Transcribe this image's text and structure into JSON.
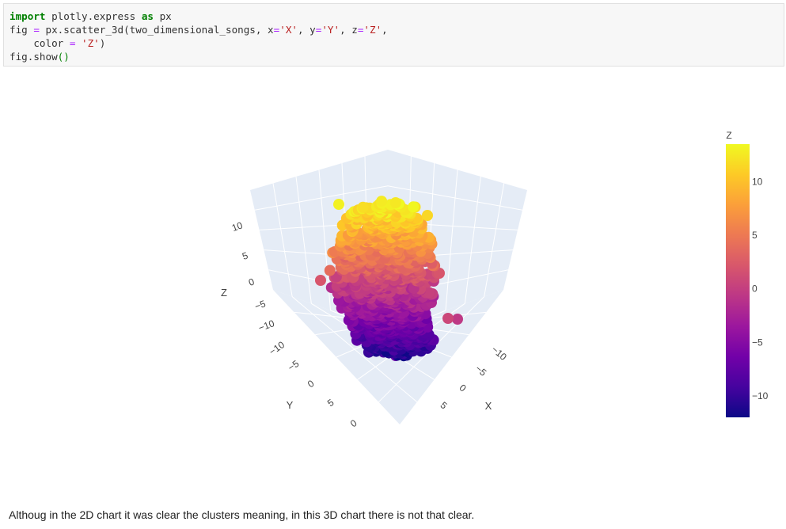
{
  "code": {
    "line1": {
      "kw1": "import",
      "mod": " plotly.express ",
      "kw2": "as",
      "alias": " px"
    },
    "line2": {
      "pre": "fig ",
      "eq": "=",
      "call": " px.scatter_3d(two_dimensional_songs, x",
      "eq2": "=",
      "xv": "'X'",
      "mid1": ", y",
      "eq3": "=",
      "yv": "'Y'",
      "mid2": ", z",
      "eq4": "=",
      "zv": "'Z'",
      "end": ","
    },
    "line3": {
      "pre": "    color ",
      "eq": "=",
      "sp": " ",
      "val": "'Z'",
      "end": ")"
    },
    "line4": {
      "pre": "fig.show",
      "paren": "()"
    }
  },
  "markdown_text": "Althoug in the 2D chart it was clear the clusters meaning, in this 3D chart there is not that clear.",
  "chart_data": {
    "type": "scatter",
    "subtype": "scatter_3d",
    "x_label": "X",
    "y_label": "Y",
    "z_label": "Z",
    "x_ticks": [
      "5",
      "0",
      "−5",
      "−10"
    ],
    "y_ticks": [
      "−10",
      "−5",
      "0",
      "5",
      "0"
    ],
    "z_ticks": [
      "10",
      "5",
      "0",
      "−5",
      "−10"
    ],
    "colorbar_title": "Z",
    "colorbar_ticks": [
      "10",
      "5",
      "0",
      "−5",
      "−10"
    ],
    "colorbar_range": [
      -12,
      13.5
    ],
    "colorscale": [
      "#0d0887",
      "#46039f",
      "#7201a8",
      "#9c179e",
      "#bd3786",
      "#d8576b",
      "#ed7953",
      "#fb9f3a",
      "#fdca26",
      "#f0f921"
    ],
    "grid": true,
    "legend_position": "right"
  }
}
